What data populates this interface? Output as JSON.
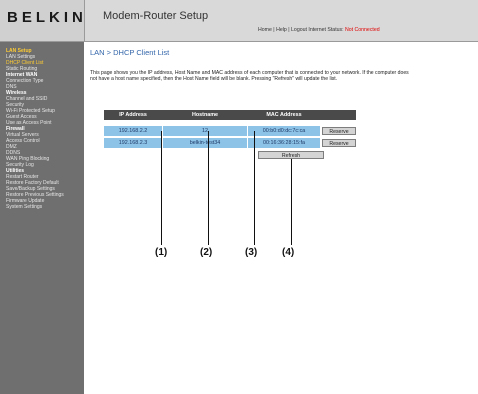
{
  "brand": "BELKIN",
  "app_title": "Modem-Router Setup",
  "top_links": {
    "home": "Home",
    "help": "Help",
    "logout": "Logout",
    "separator": "|",
    "status_label": "Internet Status:",
    "status_value": "Not Connected"
  },
  "sidebar": {
    "items": [
      {
        "label": "LAN Setup",
        "kind": "active-head"
      },
      {
        "label": "LAN Settings",
        "kind": "item"
      },
      {
        "label": "DHCP Client List",
        "kind": "active"
      },
      {
        "label": "Static Routing",
        "kind": "item"
      },
      {
        "label": "Internet WAN",
        "kind": "head"
      },
      {
        "label": "Connection Type",
        "kind": "item"
      },
      {
        "label": "DNS",
        "kind": "item"
      },
      {
        "label": "Wireless",
        "kind": "head"
      },
      {
        "label": "Channel and SSID",
        "kind": "item"
      },
      {
        "label": "Security",
        "kind": "item"
      },
      {
        "label": "Wi-Fi Protected Setup",
        "kind": "item"
      },
      {
        "label": "Guest Access",
        "kind": "item"
      },
      {
        "label": "Use as Access Point",
        "kind": "item"
      },
      {
        "label": "Firewall",
        "kind": "head"
      },
      {
        "label": "Virtual Servers",
        "kind": "item"
      },
      {
        "label": "Access Control",
        "kind": "item"
      },
      {
        "label": "DMZ",
        "kind": "item"
      },
      {
        "label": "DDNS",
        "kind": "item"
      },
      {
        "label": "WAN Ping Blocking",
        "kind": "item"
      },
      {
        "label": "Security Log",
        "kind": "item"
      },
      {
        "label": "Utilities",
        "kind": "head"
      },
      {
        "label": "Restart Router",
        "kind": "item"
      },
      {
        "label": "Restore Factory Default",
        "kind": "item"
      },
      {
        "label": "Save/Backup Settings",
        "kind": "item"
      },
      {
        "label": "Restore Previous Settings",
        "kind": "item"
      },
      {
        "label": "Firmware Update",
        "kind": "item"
      },
      {
        "label": "System Settings",
        "kind": "item"
      }
    ]
  },
  "main": {
    "title": "LAN > DHCP Client List",
    "description": "This page shows you the IP address, Host Name and MAC address of each computer that is connected to your network. If the computer does not have a host name specified, then the Host Name field will be blank. Pressing \"Refresh\" will update the list.",
    "table": {
      "headers": [
        "IP Address",
        "Hostname",
        "MAC Address",
        ""
      ],
      "rows": [
        {
          "ip": "192.168.2.2",
          "hostname": "12",
          "mac": "00:b0:d0:dc:7c:ca",
          "action": "Reserve"
        },
        {
          "ip": "192.168.2.3",
          "hostname": "belkin-test34",
          "mac": "00:16:36:28:15:fa",
          "action": "Reserve"
        }
      ]
    },
    "refresh_label": "Refresh"
  },
  "callouts": [
    "(1)",
    "(2)",
    "(3)",
    "(4)"
  ]
}
